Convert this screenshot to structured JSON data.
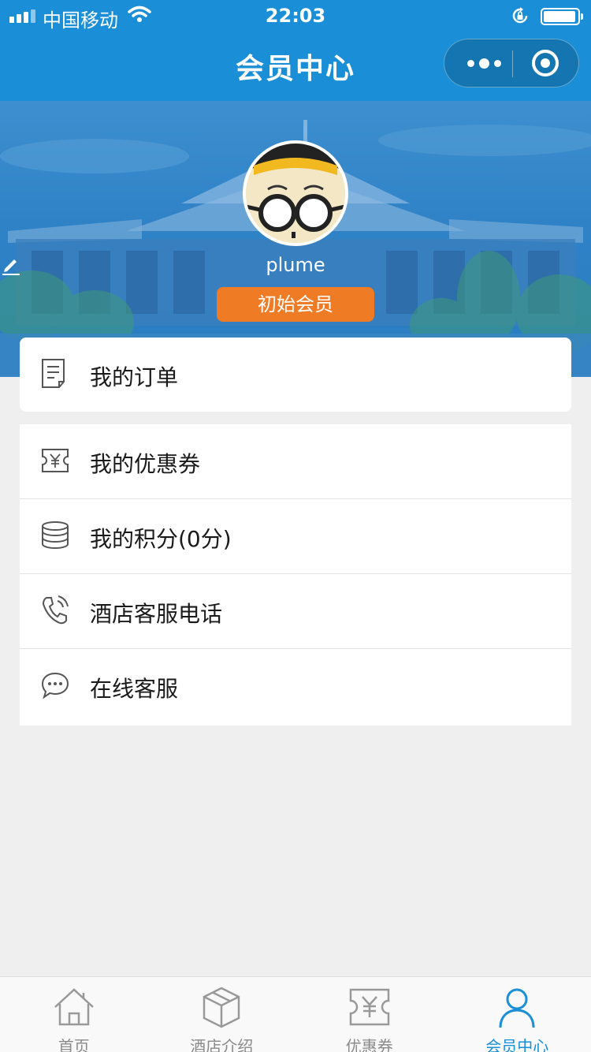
{
  "status_bar": {
    "carrier": "中国移动",
    "time": "22:03"
  },
  "nav": {
    "title": "会员中心"
  },
  "profile": {
    "username": "plume",
    "level": "初始会员"
  },
  "menu": {
    "orders": {
      "label": "我的订单",
      "icon": "document-icon"
    },
    "items": [
      {
        "label": "我的优惠券",
        "icon": "coupon-icon"
      },
      {
        "label": "我的积分(0分)",
        "icon": "coins-icon"
      },
      {
        "label": "酒店客服电话",
        "icon": "phone-icon"
      },
      {
        "label": "在线客服",
        "icon": "chat-icon"
      }
    ]
  },
  "tabbar": {
    "items": [
      {
        "label": "首页",
        "icon": "home-icon",
        "active": false
      },
      {
        "label": "酒店介绍",
        "icon": "box-icon",
        "active": false
      },
      {
        "label": "优惠券",
        "icon": "coupon-icon",
        "active": false
      },
      {
        "label": "会员中心",
        "icon": "user-icon",
        "active": true
      }
    ]
  },
  "colors": {
    "primary": "#1a8fd7",
    "badge": "#f07b25",
    "background": "#efefef"
  }
}
